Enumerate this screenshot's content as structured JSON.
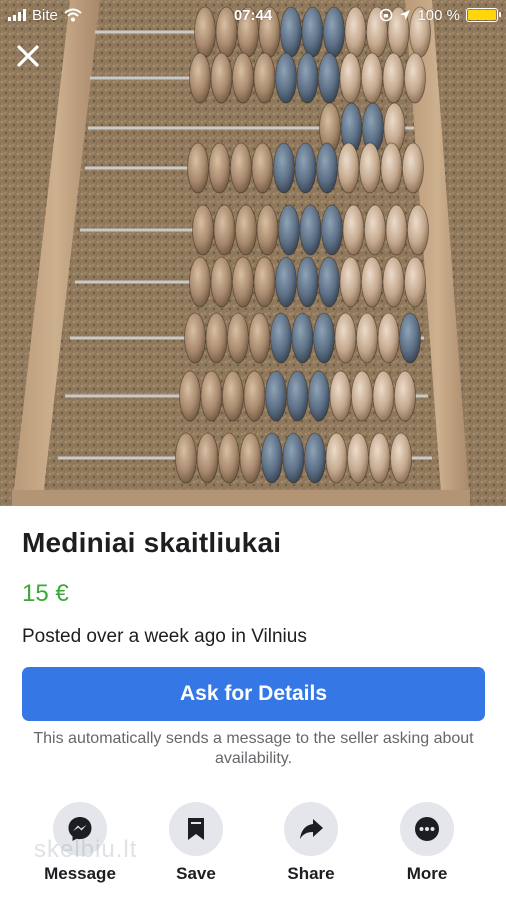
{
  "status_bar": {
    "carrier": "Bite",
    "time": "07:44",
    "battery_percent": "100 %",
    "battery_level": 1.0,
    "icons": [
      "signal-icon",
      "wifi-icon",
      "lock-rotation-icon",
      "location-icon",
      "battery-icon"
    ]
  },
  "photo": {
    "icon": "close-icon"
  },
  "listing": {
    "title": "Mediniai skaitliukai",
    "price": "15 €",
    "posted": "Posted over a week ago in Vilnius"
  },
  "cta": {
    "label": "Ask for Details",
    "notice": "This automatically sends a message to the seller asking about availability."
  },
  "actions": [
    {
      "label": "Message",
      "icon": "messenger-icon"
    },
    {
      "label": "Save",
      "icon": "bookmark-icon"
    },
    {
      "label": "Share",
      "icon": "share-icon"
    },
    {
      "label": "More",
      "icon": "more-icon"
    }
  ],
  "watermark": "skelbiu.lt",
  "colors": {
    "primary_button": "#3578e5",
    "price": "#3aaa35",
    "text": "#1c1e21",
    "secondary_text": "#65676b",
    "action_circle": "#e4e6eb"
  }
}
